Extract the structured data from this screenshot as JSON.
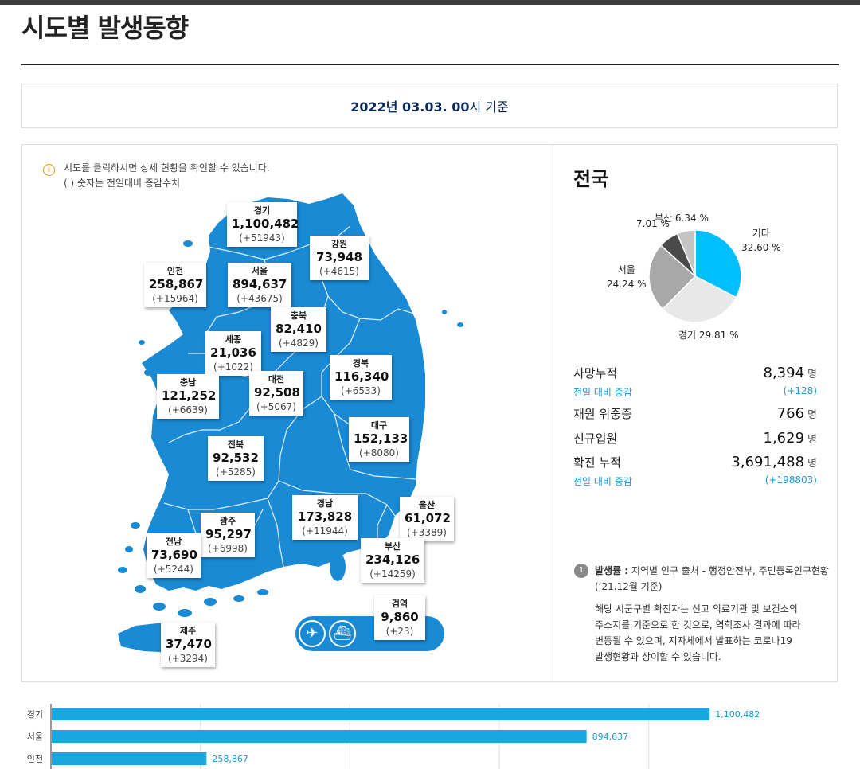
{
  "title": "시도별 발생동향",
  "date": {
    "bold": "2022년 03.03. 00",
    "rest": "시 기준"
  },
  "notice": {
    "line1": "시도를 클릭하시면 상세 현황을 확인할 수 있습니다.",
    "line2": "( ) 숫자는 전일대비 증감수치",
    "icon": "info-icon"
  },
  "regions": [
    {
      "name": "경기",
      "count": "1,100,482",
      "diff": "(+51943)"
    },
    {
      "name": "강원",
      "count": "73,948",
      "diff": "(+4615)"
    },
    {
      "name": "인천",
      "count": "258,867",
      "diff": "(+15964)"
    },
    {
      "name": "서울",
      "count": "894,637",
      "diff": "(+43675)"
    },
    {
      "name": "충북",
      "count": "82,410",
      "diff": "(+4829)"
    },
    {
      "name": "세종",
      "count": "21,036",
      "diff": "(+1022)"
    },
    {
      "name": "경북",
      "count": "116,340",
      "diff": "(+6533)"
    },
    {
      "name": "충남",
      "count": "121,252",
      "diff": "(+6639)"
    },
    {
      "name": "대전",
      "count": "92,508",
      "diff": "(+5067)"
    },
    {
      "name": "대구",
      "count": "152,133",
      "diff": "(+8080)"
    },
    {
      "name": "전북",
      "count": "92,532",
      "diff": "(+5285)"
    },
    {
      "name": "울산",
      "count": "61,072",
      "diff": "(+3389)"
    },
    {
      "name": "경남",
      "count": "173,828",
      "diff": "(+11944)"
    },
    {
      "name": "광주",
      "count": "95,297",
      "diff": "(+6998)"
    },
    {
      "name": "부산",
      "count": "234,126",
      "diff": "(+14259)"
    },
    {
      "name": "전남",
      "count": "73,690",
      "diff": "(+5244)"
    },
    {
      "name": "검역",
      "count": "9,860",
      "diff": "(+23)"
    },
    {
      "name": "제주",
      "count": "37,470",
      "diff": "(+3294)"
    }
  ],
  "quarantine_icons": [
    "airplane-icon",
    "ship-icon"
  ],
  "national": {
    "title": "전국",
    "pie": [
      {
        "label": "기타",
        "value": "32.60 %",
        "pct": 32.6,
        "color": "#00bfff"
      },
      {
        "label": "경기",
        "value": "29.81 %",
        "pct": 29.81,
        "color": "#e8e8e8"
      },
      {
        "label": "서울",
        "value": "24.24 %",
        "pct": 24.24,
        "color": "#a8a8a8"
      },
      {
        "label": "인천",
        "value": "7.01 %",
        "pct": 7.01,
        "color": "#4a4a4a"
      },
      {
        "label": "부산",
        "value": "6.34 %",
        "pct": 6.34,
        "color": "#c4c4c4"
      }
    ],
    "stats": {
      "deaths_label": "사망누적",
      "deaths": "8,394",
      "unit": "명",
      "deaths_diff_label": "전일 대비 증감",
      "deaths_diff": "(+128)",
      "severe_label": "재원 위중증",
      "severe": "766",
      "admit_label": "신규입원",
      "admit": "1,629",
      "confirmed_label": "확진 누적",
      "confirmed": "3,691,488",
      "confirmed_diff_label": "전일 대비 증감",
      "confirmed_diff": "(+198803)"
    }
  },
  "footnote": {
    "num": "1",
    "title": "발생률 :",
    "line1": " 지역별 인구 출처 - 행정안전부, 주민등록인구현황",
    "line2": "(‘21.12월 기준)",
    "line3": "해당 시군구별 확진자는 신고 의료기관 및 보건소의",
    "line4": "주소지를 기준으로 한 것으로, 역학조사 결과에 따라",
    "line5": "변동될 수 있으며, 지자체에서 발표하는 코로나19",
    "line6": "발생현황과 상이할 수 있습니다."
  },
  "chart_data": {
    "type": "bar",
    "orientation": "horizontal",
    "categories": [
      "경기",
      "서울",
      "인천"
    ],
    "values": [
      1100482,
      894637,
      258867
    ],
    "value_labels": [
      "1,100,482",
      "894,637",
      "258,867"
    ],
    "xlim": [
      0,
      1300000
    ],
    "color": "#1aa6df",
    "grid": true
  }
}
